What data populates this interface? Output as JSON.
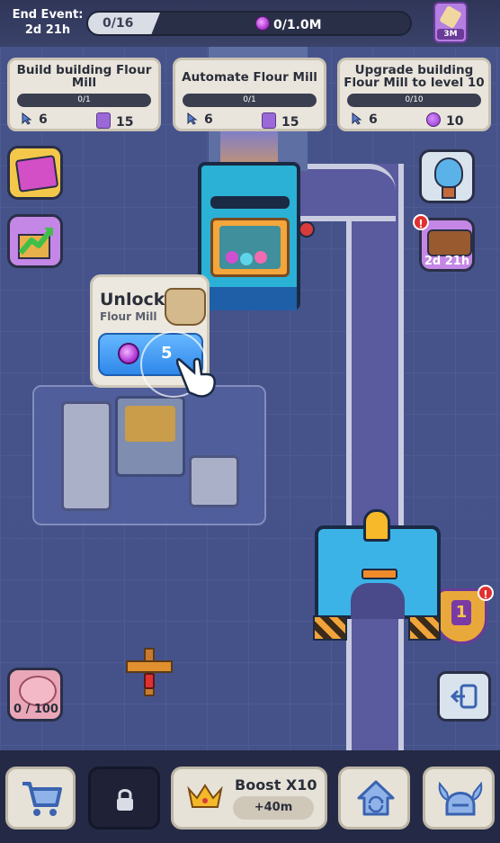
{
  "event": {
    "label": "End Event:",
    "timer": "2d 21h"
  },
  "progress": {
    "count": "0/16",
    "currency": "0/1.0M",
    "fraction": 0.0
  },
  "event_badge": {
    "label": "3M"
  },
  "quests": [
    {
      "title": "Build building Flour Mill",
      "progress": "0/1",
      "reward_a": "6",
      "reward_b": "15",
      "reward_b_icon": "ticket-icon"
    },
    {
      "title": "Automate Flour Mill",
      "progress": "0/1",
      "reward_a": "6",
      "reward_b": "15",
      "reward_b_icon": "ticket-icon"
    },
    {
      "title": "Upgrade building Flour Mill  to level 10",
      "progress": "0/10",
      "reward_a": "6",
      "reward_b": "10",
      "reward_b_icon": "potion-icon"
    }
  ],
  "side_left": {
    "piggy_label": "0 / 100"
  },
  "side_right": {
    "chest_timer": "2d 21h",
    "level_badge": "1",
    "alert": "!"
  },
  "unlock": {
    "title": "Unlock",
    "subtitle": "Flour Mill",
    "cost": "5"
  },
  "bottom": {
    "boost_title": "Boost X10",
    "boost_time": "+40m"
  },
  "colors": {
    "accent_blue": "#2f88ea",
    "currency_purple": "#b23ed6",
    "card_bg": "#e9e5dc"
  }
}
